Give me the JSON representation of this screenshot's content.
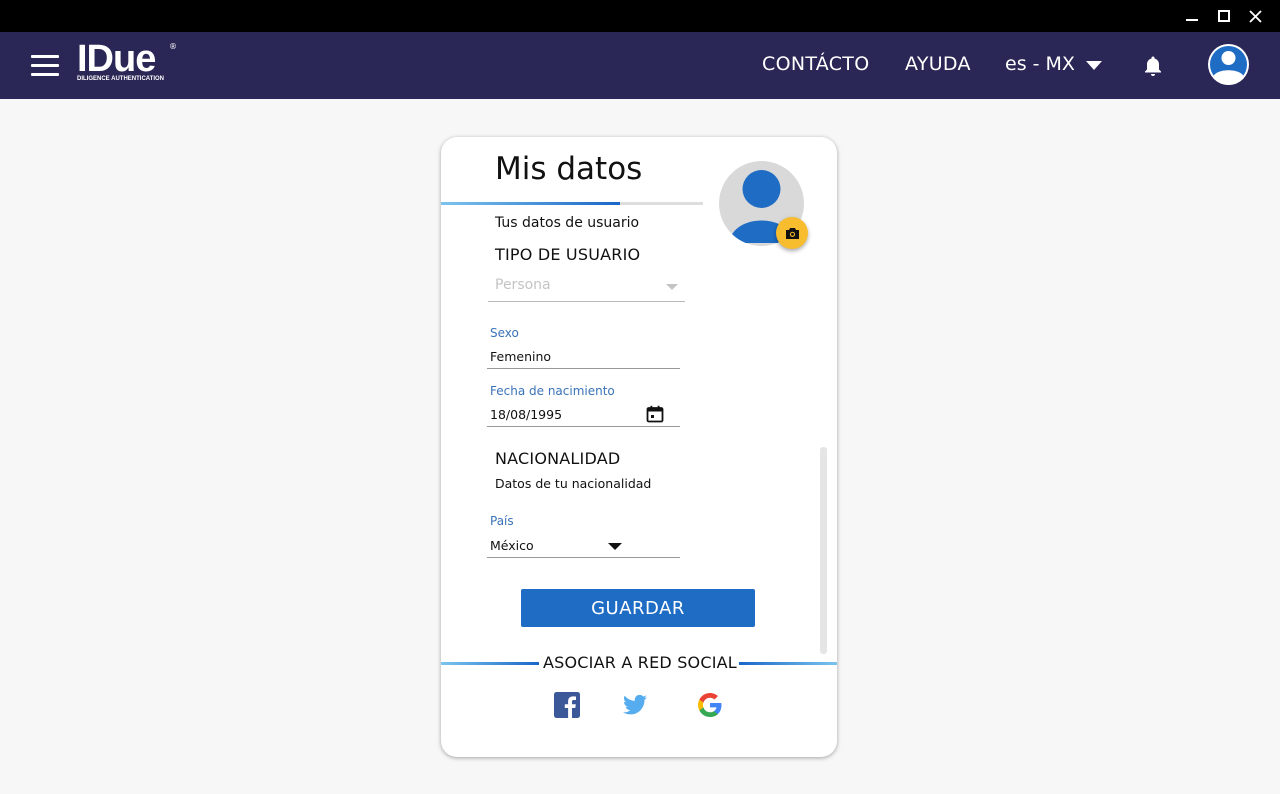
{
  "window": {
    "controls": [
      "minimize-icon",
      "maximize-icon",
      "close-icon"
    ]
  },
  "header": {
    "brand_name": "IDue",
    "brand_mark": "®",
    "brand_tagline": "DILIGENCE AUTHENTICATION",
    "nav": {
      "contact": "CONTÁCTO",
      "help": "AYUDA"
    },
    "language": "es - MX",
    "icons": [
      "menu-icon",
      "bell-icon",
      "user-avatar-icon"
    ],
    "colors": {
      "background": "#2a2655",
      "text": "#ffffff"
    }
  },
  "card": {
    "title": "Mis datos",
    "subtitle": "Tus datos de usuario",
    "user_type": {
      "heading": "TIPO DE USUARIO",
      "value": "Persona"
    },
    "sexo": {
      "label": "Sexo",
      "value": "Femenino"
    },
    "birthdate": {
      "label": "Fecha de nacimiento",
      "value": "18/08/1995"
    },
    "nationality": {
      "heading": "NACIONALIDAD",
      "subtitle": "Datos de tu nacionalidad",
      "country_label": "País",
      "country_value": "México"
    },
    "save_label": "GUARDAR",
    "social": {
      "heading": "ASOCIAR A RED SOCIAL",
      "networks": [
        "facebook-icon",
        "twitter-icon",
        "google-icon"
      ]
    },
    "colors": {
      "accent": "#1e6cc4",
      "label": "#3a73b8",
      "camera_button": "#f8bd2e"
    }
  }
}
